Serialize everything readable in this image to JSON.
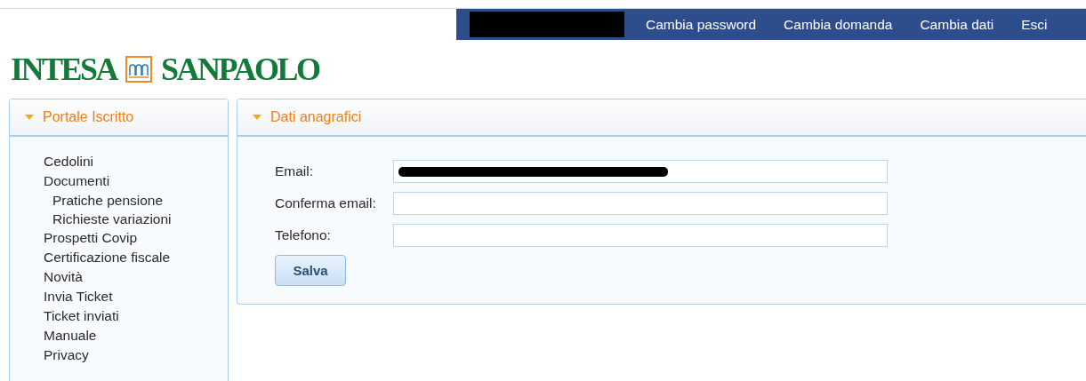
{
  "top_nav": {
    "links": [
      "Cambia password",
      "Cambia domanda",
      "Cambia dati",
      "Esci"
    ]
  },
  "logo": {
    "left": "INTESA",
    "right": "SANPAOLO"
  },
  "sidebar": {
    "title": "Portale Iscritto",
    "expanded": true,
    "items": [
      {
        "label": "Cedolini"
      },
      {
        "label": "Documenti",
        "children": [
          {
            "label": "Pratiche pensione"
          },
          {
            "label": "Richieste variazioni"
          }
        ]
      },
      {
        "label": "Prospetti Covip"
      },
      {
        "label": "Certificazione fiscale"
      },
      {
        "label": "Novità"
      },
      {
        "label": "Invia Ticket"
      },
      {
        "label": "Ticket inviati"
      },
      {
        "label": "Manuale"
      },
      {
        "label": "Privacy"
      }
    ]
  },
  "panel": {
    "title": "Dati anagrafici",
    "expanded": true,
    "fields": [
      {
        "label": "Email:",
        "redacted": true
      },
      {
        "label": "Conferma email:",
        "redacted": false
      },
      {
        "label": "Telefono:",
        "redacted": false
      }
    ],
    "button": "Salva"
  }
}
